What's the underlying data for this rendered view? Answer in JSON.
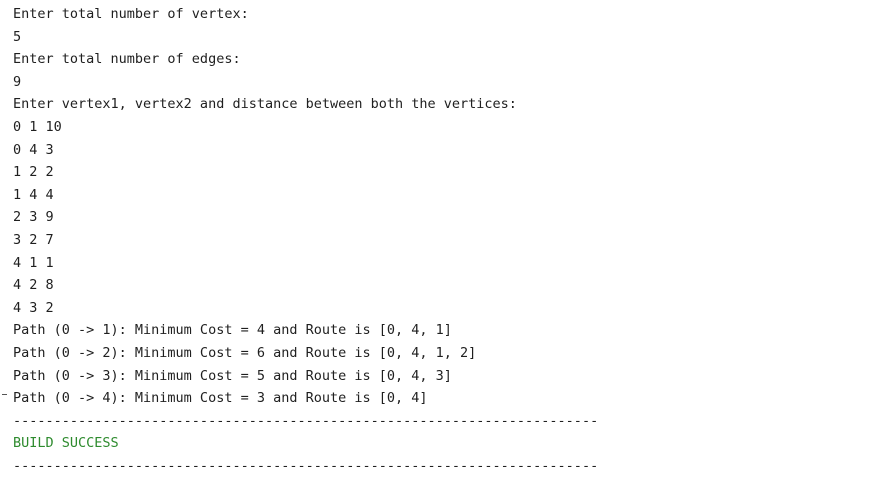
{
  "console": {
    "lines": [
      "Enter total number of vertex:",
      "5",
      "Enter total number of edges:",
      "9",
      "Enter vertex1, vertex2 and distance between both the vertices:",
      "0 1 10",
      "0 4 3",
      "1 2 2",
      "1 4 4",
      "2 3 9",
      "3 2 7",
      "4 1 1",
      "4 2 8",
      "4 3 2",
      "Path (0 -> 1): Minimum Cost = 4 and Route is [0, 4, 1]",
      "Path (0 -> 2): Minimum Cost = 6 and Route is [0, 4, 1, 2]",
      "Path (0 -> 3): Minimum Cost = 5 and Route is [0, 4, 3]",
      "Path (0 -> 4): Minimum Cost = 3 and Route is [0, 4]"
    ],
    "separator": "------------------------------------------------------------------------",
    "build_status": "BUILD SUCCESS",
    "separator_bottom": "------------------------------------------------------------------------",
    "success_color": "#2e8b2e"
  }
}
